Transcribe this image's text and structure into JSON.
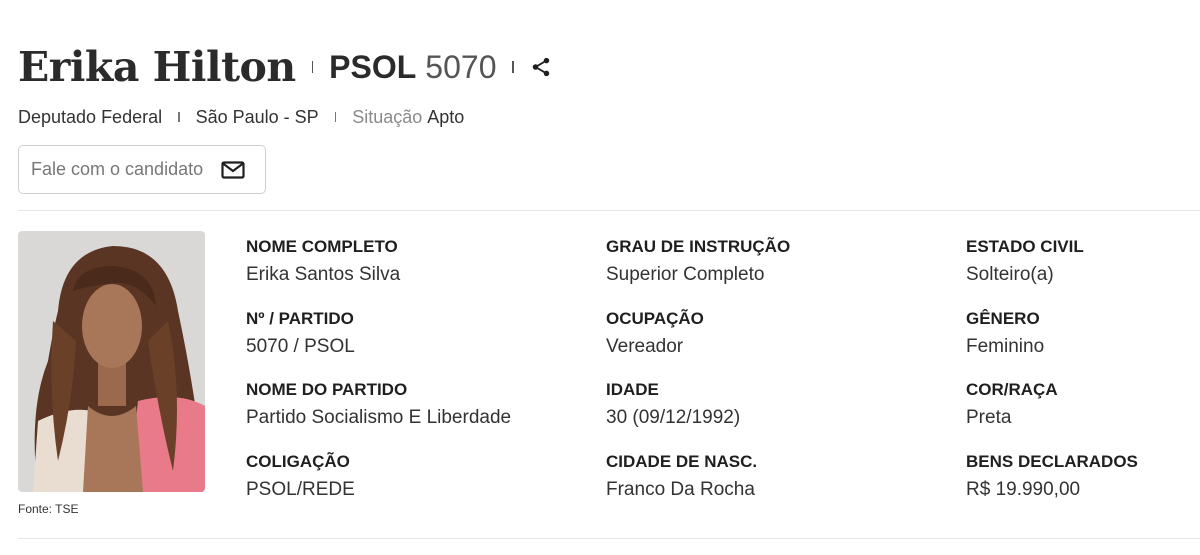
{
  "header": {
    "name": "Erika Hilton",
    "party": "PSOL",
    "number": "5070"
  },
  "subline": {
    "office": "Deputado Federal",
    "location": "São Paulo - SP",
    "status_label": "Situação",
    "status_value": "Apto"
  },
  "contact": {
    "label": "Fale com o candidato"
  },
  "photo": {
    "caption": "Fonte: TSE"
  },
  "fields": [
    {
      "label": "NOME COMPLETO",
      "value": "Erika Santos Silva"
    },
    {
      "label": "Nº / PARTIDO",
      "value": "5070 / PSOL"
    },
    {
      "label": "NOME DO PARTIDO",
      "value": "Partido Socialismo E Liberdade"
    },
    {
      "label": "COLIGAÇÃO",
      "value": "PSOL/REDE"
    },
    {
      "label": "GRAU DE INSTRUÇÃO",
      "value": "Superior Completo"
    },
    {
      "label": "OCUPAÇÃO",
      "value": "Vereador"
    },
    {
      "label": "IDADE",
      "value": "30 (09/12/1992)"
    },
    {
      "label": "CIDADE DE NASC.",
      "value": "Franco Da Rocha"
    },
    {
      "label": "ESTADO CIVIL",
      "value": "Solteiro(a)"
    },
    {
      "label": "GÊNERO",
      "value": "Feminino"
    },
    {
      "label": "COR/RAÇA",
      "value": "Preta"
    },
    {
      "label": "BENS DECLARADOS",
      "value": "R$ 19.990,00"
    }
  ],
  "icons": {
    "share": "share-icon",
    "mail": "mail-icon"
  },
  "colors": {
    "text": "#2b2b2b",
    "muted": "#8a8a8a",
    "border": "#cfcfcf",
    "photo_bg": "#d9d8d6"
  }
}
